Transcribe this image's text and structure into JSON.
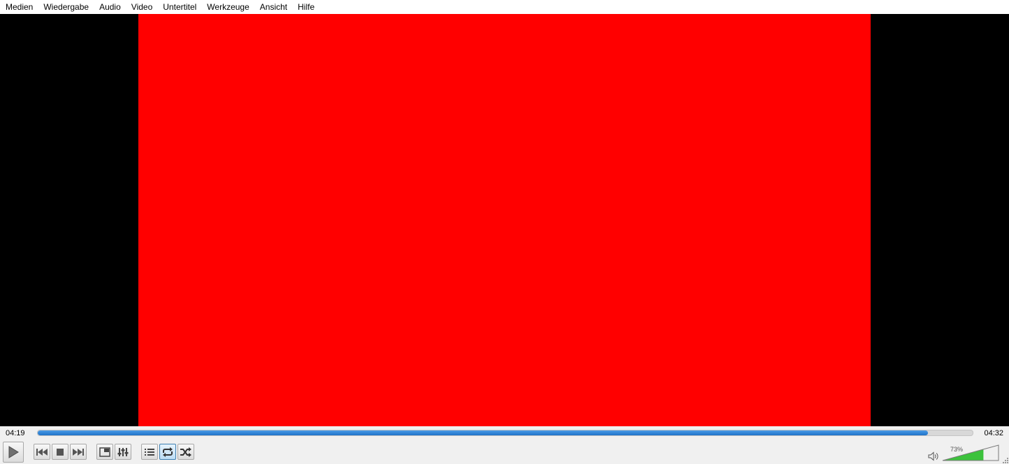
{
  "menubar": {
    "items": [
      {
        "name": "menu-medien",
        "label": "Medien"
      },
      {
        "name": "menu-wiedergabe",
        "label": "Wiedergabe"
      },
      {
        "name": "menu-audio",
        "label": "Audio"
      },
      {
        "name": "menu-video",
        "label": "Video"
      },
      {
        "name": "menu-untertitel",
        "label": "Untertitel"
      },
      {
        "name": "menu-werkzeuge",
        "label": "Werkzeuge"
      },
      {
        "name": "menu-ansicht",
        "label": "Ansicht"
      },
      {
        "name": "menu-hilfe",
        "label": "Hilfe"
      }
    ]
  },
  "video": {
    "frame_color": "#ff0000",
    "background_color": "#000000"
  },
  "seek": {
    "elapsed": "04:19",
    "total": "04:32",
    "progress": 0.952,
    "fill_color": "#2a7fd4"
  },
  "controls": {
    "play_icon": "play-icon",
    "previous_icon": "previous-icon",
    "stop_icon": "stop-icon",
    "next_icon": "next-icon",
    "fullscreen_icon": "fullscreen-icon",
    "extended_settings_icon": "equalizer-icon",
    "playlist_icon": "playlist-icon",
    "loop_icon": "loop-icon",
    "loop_active": true,
    "shuffle_icon": "shuffle-icon"
  },
  "volume": {
    "percent_label": "73%",
    "level": 0.73,
    "fill_color": "#3cc23c",
    "speaker_icon": "speaker-icon"
  }
}
